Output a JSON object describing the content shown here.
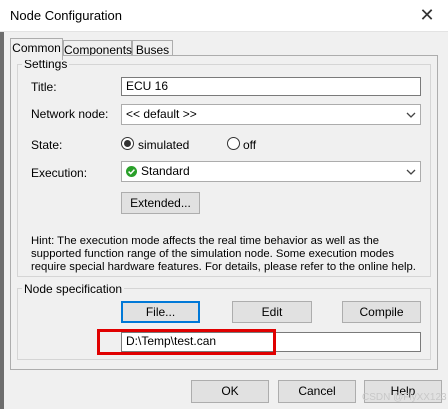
{
  "window": {
    "title": "Node Configuration",
    "close_glyph": "✕"
  },
  "tabs": [
    {
      "label": "Common",
      "active": true
    },
    {
      "label": "Components",
      "active": false
    },
    {
      "label": "Buses",
      "active": false
    }
  ],
  "settings": {
    "legend": "Settings",
    "title_label": "Title:",
    "title_value": "ECU 16",
    "network_label": "Network node:",
    "network_value": "<< default >>",
    "state_label": "State:",
    "state_options": [
      {
        "label": "simulated",
        "selected": true
      },
      {
        "label": "off",
        "selected": false
      }
    ],
    "execution_label": "Execution:",
    "execution_value": "Standard",
    "execution_icon": "check-circle-icon",
    "extended_button": "Extended...",
    "hint": "Hint: The execution mode affects the real time behavior as well as the supported function range of the simulation node. Some execution modes require special hardware features. For details, please refer to the online help."
  },
  "node_spec": {
    "legend": "Node specification",
    "file_button": "File...",
    "edit_button": "Edit",
    "compile_button": "Compile",
    "path_value": "D:\\Temp\\test.can"
  },
  "dialog_buttons": {
    "ok": "OK",
    "cancel": "Cancel",
    "help": "Help"
  },
  "watermark": "CSDN @FlyXX123",
  "colors": {
    "highlight_box": "#e00000",
    "check_icon": "#2aa02a",
    "focus_border": "#0078d7"
  }
}
